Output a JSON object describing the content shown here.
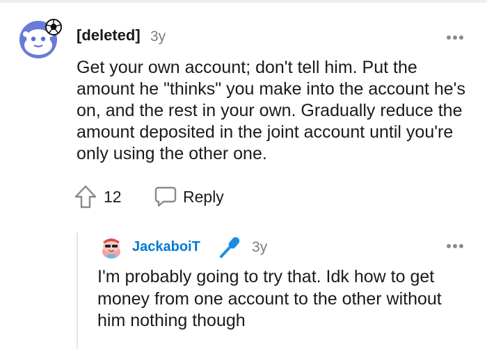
{
  "comment": {
    "author": "[deleted]",
    "age": "3y",
    "body": "Get your own account; don't tell him. Put the amount he \"thinks\" you make into the account he's on, and the rest in your own. Gradually reduce the amount deposited in the joint account until you're only using the other one.",
    "score": "12",
    "reply_label": "Reply",
    "avatar_icon": "deleted-user-snoo-icon",
    "more_icon": "more-options-icon",
    "upvote_icon": "upvote-arrow-icon",
    "reply_icon": "speech-bubble-icon"
  },
  "reply": {
    "author": "JackaboiT",
    "age": "3y",
    "body": "I'm probably going to try that. Idk how to get money from one account to the other without him nothing though",
    "avatar_icon": "user-avatar-icon",
    "flair_icon": "microphone-icon",
    "more_icon": "more-options-icon"
  },
  "colors": {
    "accent": "#0079d3",
    "text": "#1a1a1b",
    "muted": "#7c7c7c",
    "avatar_bg": "#6a7bd6"
  }
}
